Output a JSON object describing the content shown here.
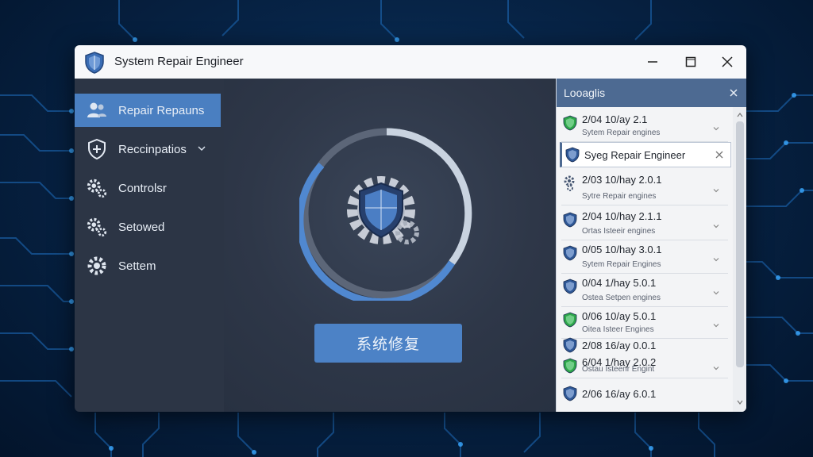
{
  "window": {
    "title": "System Repair Engineer",
    "app_icon": "shield-icon",
    "controls": {
      "minimize": "minimize-icon",
      "maximize": "maximize-icon",
      "close": "close-icon"
    }
  },
  "sidebar": {
    "items": [
      {
        "label": "Repair Repauns",
        "icon": "users-icon",
        "active": true
      },
      {
        "label": "Reccinpatios",
        "icon": "shield-plus-icon",
        "has_dropdown": true
      },
      {
        "label": "Controlsr",
        "icon": "gears-icon"
      },
      {
        "label": "Setowed",
        "icon": "gears-icon"
      },
      {
        "label": "Settem",
        "icon": "gear-icon"
      }
    ]
  },
  "main": {
    "progress_icon": "shield-gear-icon",
    "repair_button_label": "系统修复"
  },
  "log_panel": {
    "title": "Looaglis",
    "entries": [
      {
        "main": "2/04 10/ay 2.1",
        "sub": "Sytem Repair engines",
        "icon": "green-shield-icon"
      },
      {
        "main": "Syeg Repair Engineer",
        "sub": "",
        "icon": "blue-shield-icon",
        "selected": true
      },
      {
        "main": "2/03 10/hay 2.0.1",
        "sub": "Sytre Repair engines",
        "icon": "gears-icon"
      },
      {
        "main": "2/04 10/hay 2.1.1",
        "sub": "Ortas Isteeir engines",
        "icon": "blue-shield-icon"
      },
      {
        "main": "0/05 10/hay 3.0.1",
        "sub": "Sytem Repair Engines",
        "icon": "blue-shield-icon"
      },
      {
        "main": "0/04 1/hay 5.0.1",
        "sub": "Ostea Setpen engines",
        "icon": "blue-shield-icon"
      },
      {
        "main": "0/06 10/ay 5.0.1",
        "sub": "Oitea Isteer Engines",
        "icon": "green-shield-icon"
      },
      {
        "main": "2/08 16/ay 0.0.1",
        "sub": "",
        "icon": "blue-shield-icon"
      },
      {
        "main": "6/04 1/hay 2.0.2",
        "sub": "Ostau Isteenr Engint",
        "icon": "green-shield-icon"
      },
      {
        "main": "2/06 16/ay 6.0.1",
        "sub": "",
        "icon": "blue-shield-icon"
      }
    ]
  },
  "colors": {
    "accent": "#4a7fc1",
    "panel_header": "#4d6a92",
    "window_body": "#2c3545"
  }
}
